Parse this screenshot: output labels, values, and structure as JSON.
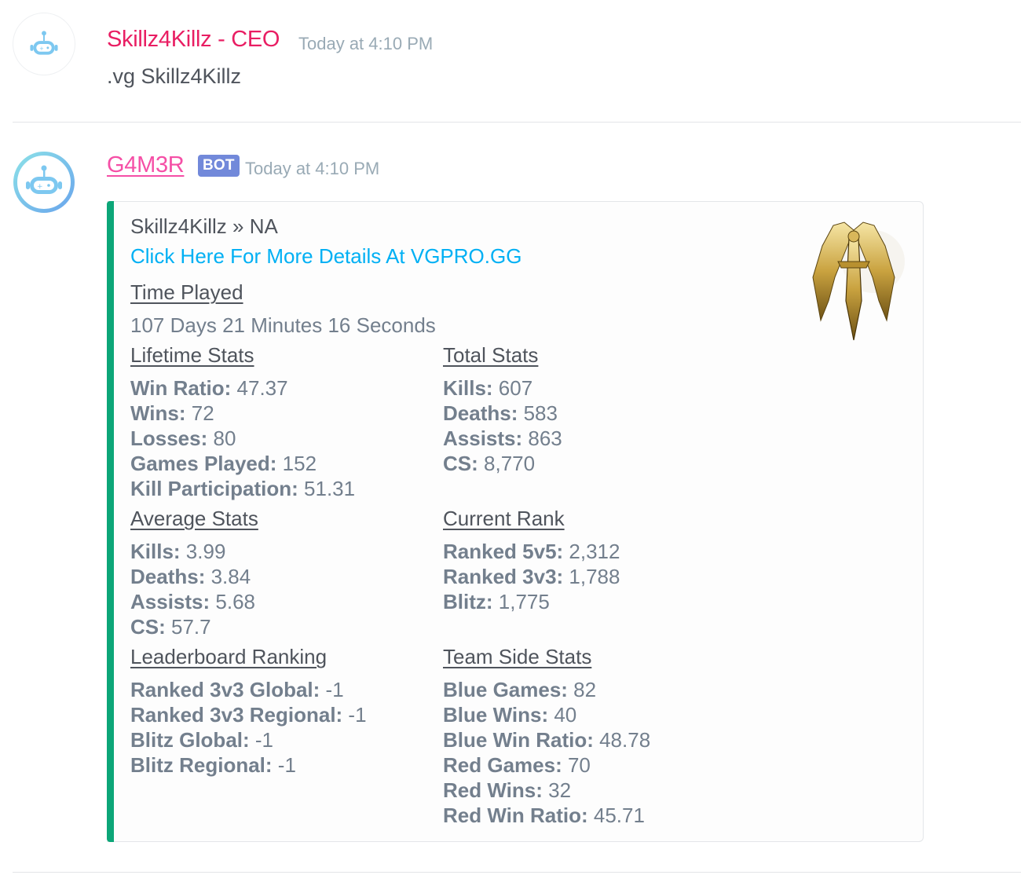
{
  "messages": [
    {
      "username": "Skillz4Killz - CEO",
      "username_color": "#e91e63",
      "timestamp": "Today at 4:10 PM",
      "content": ".vg Skillz4Killz",
      "avatar_icon": "robot-icon"
    },
    {
      "username": "G4M3R",
      "username_color": "#f54fa6",
      "bot_tag": "BOT",
      "timestamp": "Today at 4:10 PM",
      "avatar_icon": "robot-icon",
      "embed": {
        "accent_color": "#0ca678",
        "author": "Skillz4Killz » NA",
        "link_text": "Click Here For More Details At VGPRO.GG",
        "thumbnail_icon": "golden-winged-sword-icon",
        "time_played": {
          "name": "Time Played",
          "value": "107 Days 21 Minutes 16 Seconds"
        },
        "lifetime": {
          "name": "Lifetime Stats",
          "items": [
            {
              "label": "Win Ratio:",
              "value": "47.37"
            },
            {
              "label": "Wins:",
              "value": "72"
            },
            {
              "label": "Losses:",
              "value": "80"
            },
            {
              "label": "Games Played:",
              "value": "152"
            },
            {
              "label": "Kill Participation:",
              "value": "51.31"
            }
          ]
        },
        "total": {
          "name": "Total Stats",
          "items": [
            {
              "label": "Kills:",
              "value": "607"
            },
            {
              "label": "Deaths:",
              "value": "583"
            },
            {
              "label": "Assists:",
              "value": "863"
            },
            {
              "label": "CS:",
              "value": "8,770"
            }
          ]
        },
        "average": {
          "name": "Average Stats",
          "items": [
            {
              "label": "Kills:",
              "value": "3.99"
            },
            {
              "label": "Deaths:",
              "value": "3.84"
            },
            {
              "label": "Assists:",
              "value": "5.68"
            },
            {
              "label": "CS:",
              "value": "57.7"
            }
          ]
        },
        "rank": {
          "name": "Current Rank",
          "items": [
            {
              "label": "Ranked 5v5:",
              "value": "2,312"
            },
            {
              "label": "Ranked 3v3:",
              "value": "1,788"
            },
            {
              "label": "Blitz:",
              "value": "1,775"
            }
          ]
        },
        "leaderboard": {
          "name": "Leaderboard Ranking",
          "items": [
            {
              "label": "Ranked 3v3 Global:",
              "value": "-1"
            },
            {
              "label": "Ranked 3v3 Regional:",
              "value": "-1"
            },
            {
              "label": "Blitz Global:",
              "value": "-1"
            },
            {
              "label": "Blitz Regional:",
              "value": "-1"
            }
          ]
        },
        "team_side": {
          "name": "Team Side Stats",
          "items": [
            {
              "label": "Blue Games:",
              "value": "82"
            },
            {
              "label": "Blue Wins:",
              "value": "40"
            },
            {
              "label": "Blue Win Ratio:",
              "value": "48.78"
            },
            {
              "label": "Red Games:",
              "value": "70"
            },
            {
              "label": "Red Wins:",
              "value": "32"
            },
            {
              "label": "Red Win Ratio:",
              "value": "45.71"
            }
          ]
        }
      }
    }
  ]
}
